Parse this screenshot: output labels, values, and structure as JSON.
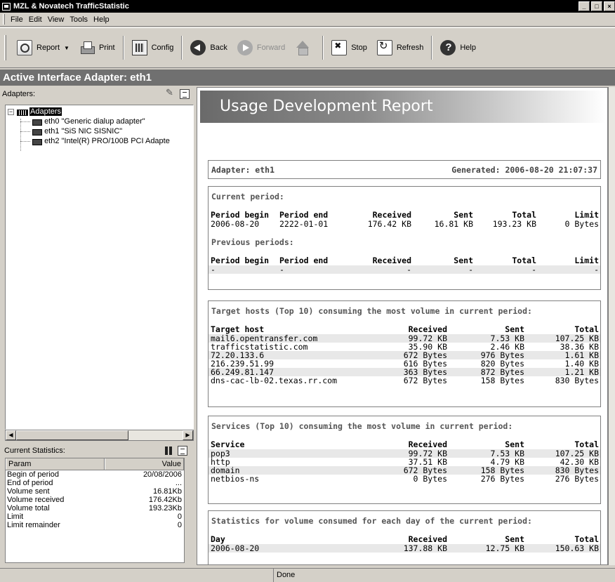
{
  "window": {
    "title": "MZL & Novatech TrafficStatistic",
    "controls": [
      "_",
      "□",
      "×"
    ]
  },
  "menu": [
    "File",
    "Edit",
    "View",
    "Tools",
    "Help"
  ],
  "toolbar": {
    "report": "Report",
    "print": "Print",
    "config": "Config",
    "back": "Back",
    "forward": "Forward",
    "stop": "Stop",
    "refresh": "Refresh",
    "help": "Help"
  },
  "active_adapter": "Active Interface Adapter: eth1",
  "adapters_panel": {
    "label": "Adapters:",
    "root": "Adapters",
    "items": [
      "eth0 \"Generic dialup adapter\"",
      "eth1 \"SiS NIC SISNIC\"",
      "eth2 \"Intel(R) PRO/100B PCI Adapte"
    ]
  },
  "current_stats": {
    "label": "Current Statistics:",
    "col_param": "Param",
    "col_value": "Value",
    "rows": [
      {
        "p": "Begin of period",
        "v": "20/08/2006"
      },
      {
        "p": "End of period",
        "v": "..."
      },
      {
        "p": "Volume sent",
        "v": "16.81Kb"
      },
      {
        "p": "Volume received",
        "v": "176.42Kb"
      },
      {
        "p": "Volume total",
        "v": "193.23Kb"
      },
      {
        "p": "Limit",
        "v": "0"
      },
      {
        "p": "Limit remainder",
        "v": "0"
      }
    ]
  },
  "report": {
    "title": "Usage Development Report",
    "adapter": "Adapter: eth1",
    "generated": "Generated: 2006-08-20 21:07:37",
    "current_period": {
      "title": "Current period:",
      "headers": [
        "Period begin",
        "Period end",
        "Received",
        "Sent",
        "Total",
        "Limit"
      ],
      "rows": [
        [
          "2006-08-20",
          "2222-01-01",
          "176.42 KB",
          "16.81 KB",
          "193.23 KB",
          "0 Bytes"
        ]
      ]
    },
    "previous_periods": {
      "title": "Previous periods:",
      "headers": [
        "Period begin",
        "Period end",
        "Received",
        "Sent",
        "Total",
        "Limit"
      ],
      "rows": [
        [
          "-",
          "-",
          "-",
          "-",
          "-",
          "-"
        ]
      ]
    },
    "target_hosts": {
      "title": "Target hosts (Top 10) consuming the most volume in current period:",
      "headers": [
        "Target host",
        "Received",
        "Sent",
        "Total"
      ],
      "rows": [
        [
          "mail6.opentransfer.com",
          "99.72 KB",
          "7.53 KB",
          "107.25 KB"
        ],
        [
          "trafficstatistic.com",
          "35.90 KB",
          "2.46 KB",
          "38.36 KB"
        ],
        [
          "72.20.133.6",
          "672 Bytes",
          "976 Bytes",
          "1.61 KB"
        ],
        [
          "216.239.51.99",
          "616 Bytes",
          "820 Bytes",
          "1.40 KB"
        ],
        [
          "66.249.81.147",
          "363 Bytes",
          "872 Bytes",
          "1.21 KB"
        ],
        [
          "dns-cac-lb-02.texas.rr.com",
          "672 Bytes",
          "158 Bytes",
          "830 Bytes"
        ]
      ]
    },
    "services": {
      "title": "Services (Top 10) consuming the most volume in current period:",
      "headers": [
        "Service",
        "Received",
        "Sent",
        "Total"
      ],
      "rows": [
        [
          "pop3",
          "99.72 KB",
          "7.53 KB",
          "107.25 KB"
        ],
        [
          "http",
          "37.51 KB",
          "4.79 KB",
          "42.30 KB"
        ],
        [
          "domain",
          "672 Bytes",
          "158 Bytes",
          "830 Bytes"
        ],
        [
          "netbios-ns",
          "0 Bytes",
          "276 Bytes",
          "276 Bytes"
        ]
      ]
    },
    "daily": {
      "title": "Statistics for volume consumed for each day of the current period:",
      "headers": [
        "Day",
        "Received",
        "Sent",
        "Total"
      ],
      "rows": [
        [
          "2006-08-20",
          "137.88 KB",
          "12.75 KB",
          "150.63 KB"
        ]
      ]
    }
  },
  "status": {
    "text": "Done"
  }
}
